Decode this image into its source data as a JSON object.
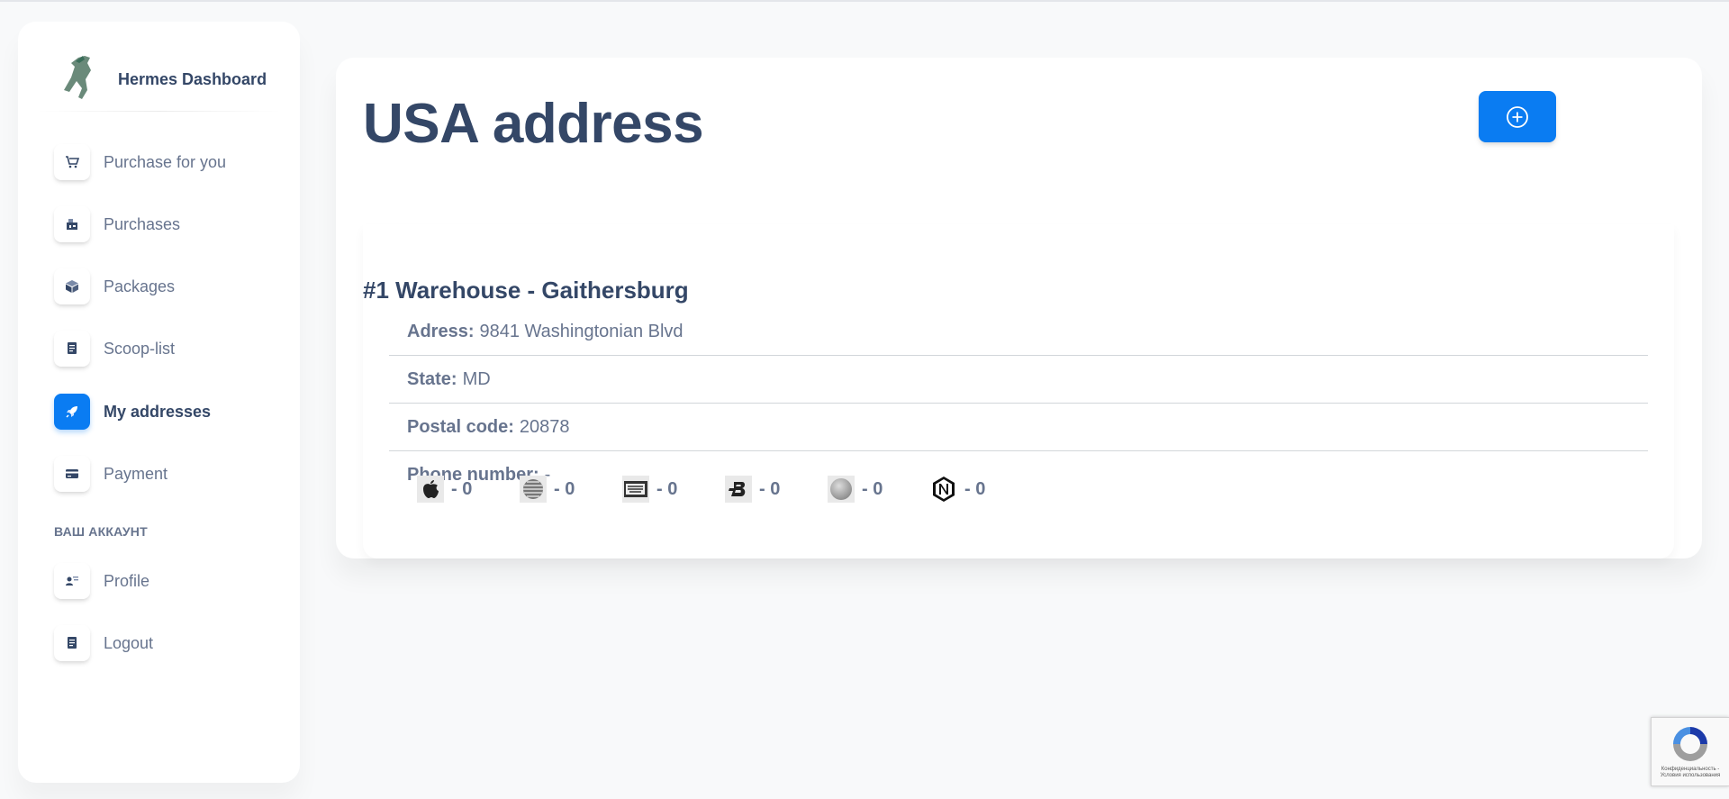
{
  "brand": {
    "name": "Hermes Dashboard"
  },
  "sidebar": {
    "items": [
      {
        "label": "Purchase for you",
        "icon": "cart-icon"
      },
      {
        "label": "Purchases",
        "icon": "shop-icon"
      },
      {
        "label": "Packages",
        "icon": "box-icon"
      },
      {
        "label": "Scoop-list",
        "icon": "document-icon"
      },
      {
        "label": "My addresses",
        "icon": "rocket-icon",
        "active": true
      },
      {
        "label": "Payment",
        "icon": "credit-card-icon"
      }
    ],
    "section_heading": "ВАШ АККАУНТ",
    "account_items": [
      {
        "label": "Profile",
        "icon": "user-icon"
      },
      {
        "label": "Logout",
        "icon": "document-icon"
      }
    ]
  },
  "main": {
    "title": "USA address",
    "warehouse": {
      "title": "#1 Warehouse - Gaithersburg",
      "fields": [
        {
          "key": "Adress:",
          "value": "9841 Washingtonian Blvd"
        },
        {
          "key": "State:",
          "value": "MD"
        },
        {
          "key": "Postal code:",
          "value": "20878"
        },
        {
          "key": "Phone number:",
          "value": "-"
        }
      ],
      "stores": [
        {
          "icon": "apple-logo-icon",
          "count": "- 0"
        },
        {
          "icon": "att-logo-icon",
          "count": "- 0"
        },
        {
          "icon": "bestbuy-logo-icon",
          "count": "- 0"
        },
        {
          "icon": "bodybuilding-logo-icon",
          "count": "- 0"
        },
        {
          "icon": "sphere-logo-icon",
          "count": "- 0"
        },
        {
          "icon": "nordstrom-logo-icon",
          "count": "- 0"
        }
      ]
    }
  },
  "recaptcha": {
    "text": "Конфиденциальность - Условия использования"
  },
  "colors": {
    "accent": "#0a7cf2",
    "heading": "#344767",
    "text": "#67748e"
  }
}
